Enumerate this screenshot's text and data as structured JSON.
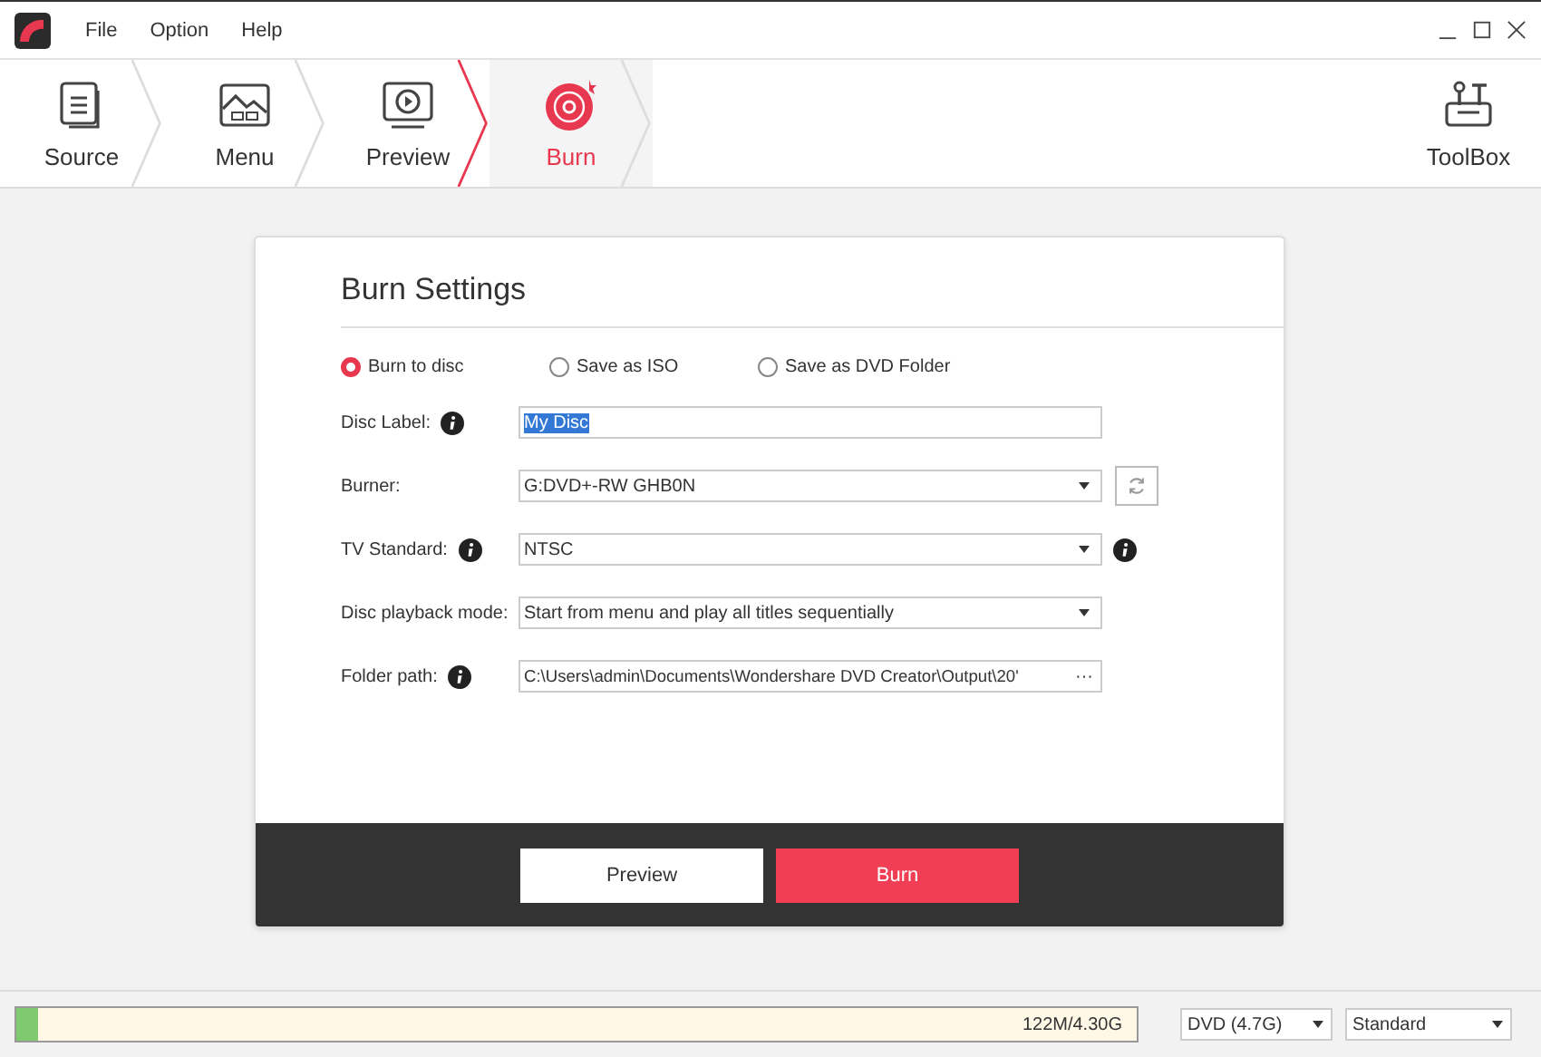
{
  "menu": [
    "File",
    "Option",
    "Help"
  ],
  "steps": [
    {
      "kind": "source",
      "label": "Source",
      "selected": false
    },
    {
      "kind": "menu",
      "label": "Menu",
      "selected": false
    },
    {
      "kind": "preview",
      "label": "Preview",
      "selected": false
    },
    {
      "kind": "burn",
      "label": "Burn",
      "selected": true
    }
  ],
  "toolbox": {
    "label": "ToolBox"
  },
  "settings": {
    "title": "Burn Settings",
    "targets": [
      {
        "label": "Burn to disc",
        "selected": true
      },
      {
        "label": "Save as ISO",
        "selected": false
      },
      {
        "label": "Save as DVD Folder",
        "selected": false
      }
    ],
    "fields": [
      {
        "kind": "text",
        "label": "Disc Label:",
        "info": true,
        "value": "My Disc"
      },
      {
        "kind": "select",
        "label": "Burner:",
        "info": false,
        "value": "G:DVD+-RW GHB0N",
        "refresh": true
      },
      {
        "kind": "select",
        "label": "TV Standard:",
        "info": true,
        "value": "NTSC",
        "trailing_info": true
      },
      {
        "kind": "select",
        "label": "Disc playback mode:",
        "info": false,
        "value": "Start from menu and play all titles sequentially"
      },
      {
        "kind": "path",
        "label": "Folder path:",
        "info": true,
        "value": "C:\\Users\\admin\\Documents\\Wondershare DVD Creator\\Output\\20'",
        "more": "···"
      }
    ],
    "buttons": [
      {
        "kind": "secondary",
        "label": "Preview"
      },
      {
        "kind": "primary",
        "label": "Burn"
      }
    ]
  },
  "status": {
    "level": 0.02,
    "reading": "122M/4.30G",
    "disc_type": "DVD (4.7G)",
    "quality": "Standard"
  }
}
